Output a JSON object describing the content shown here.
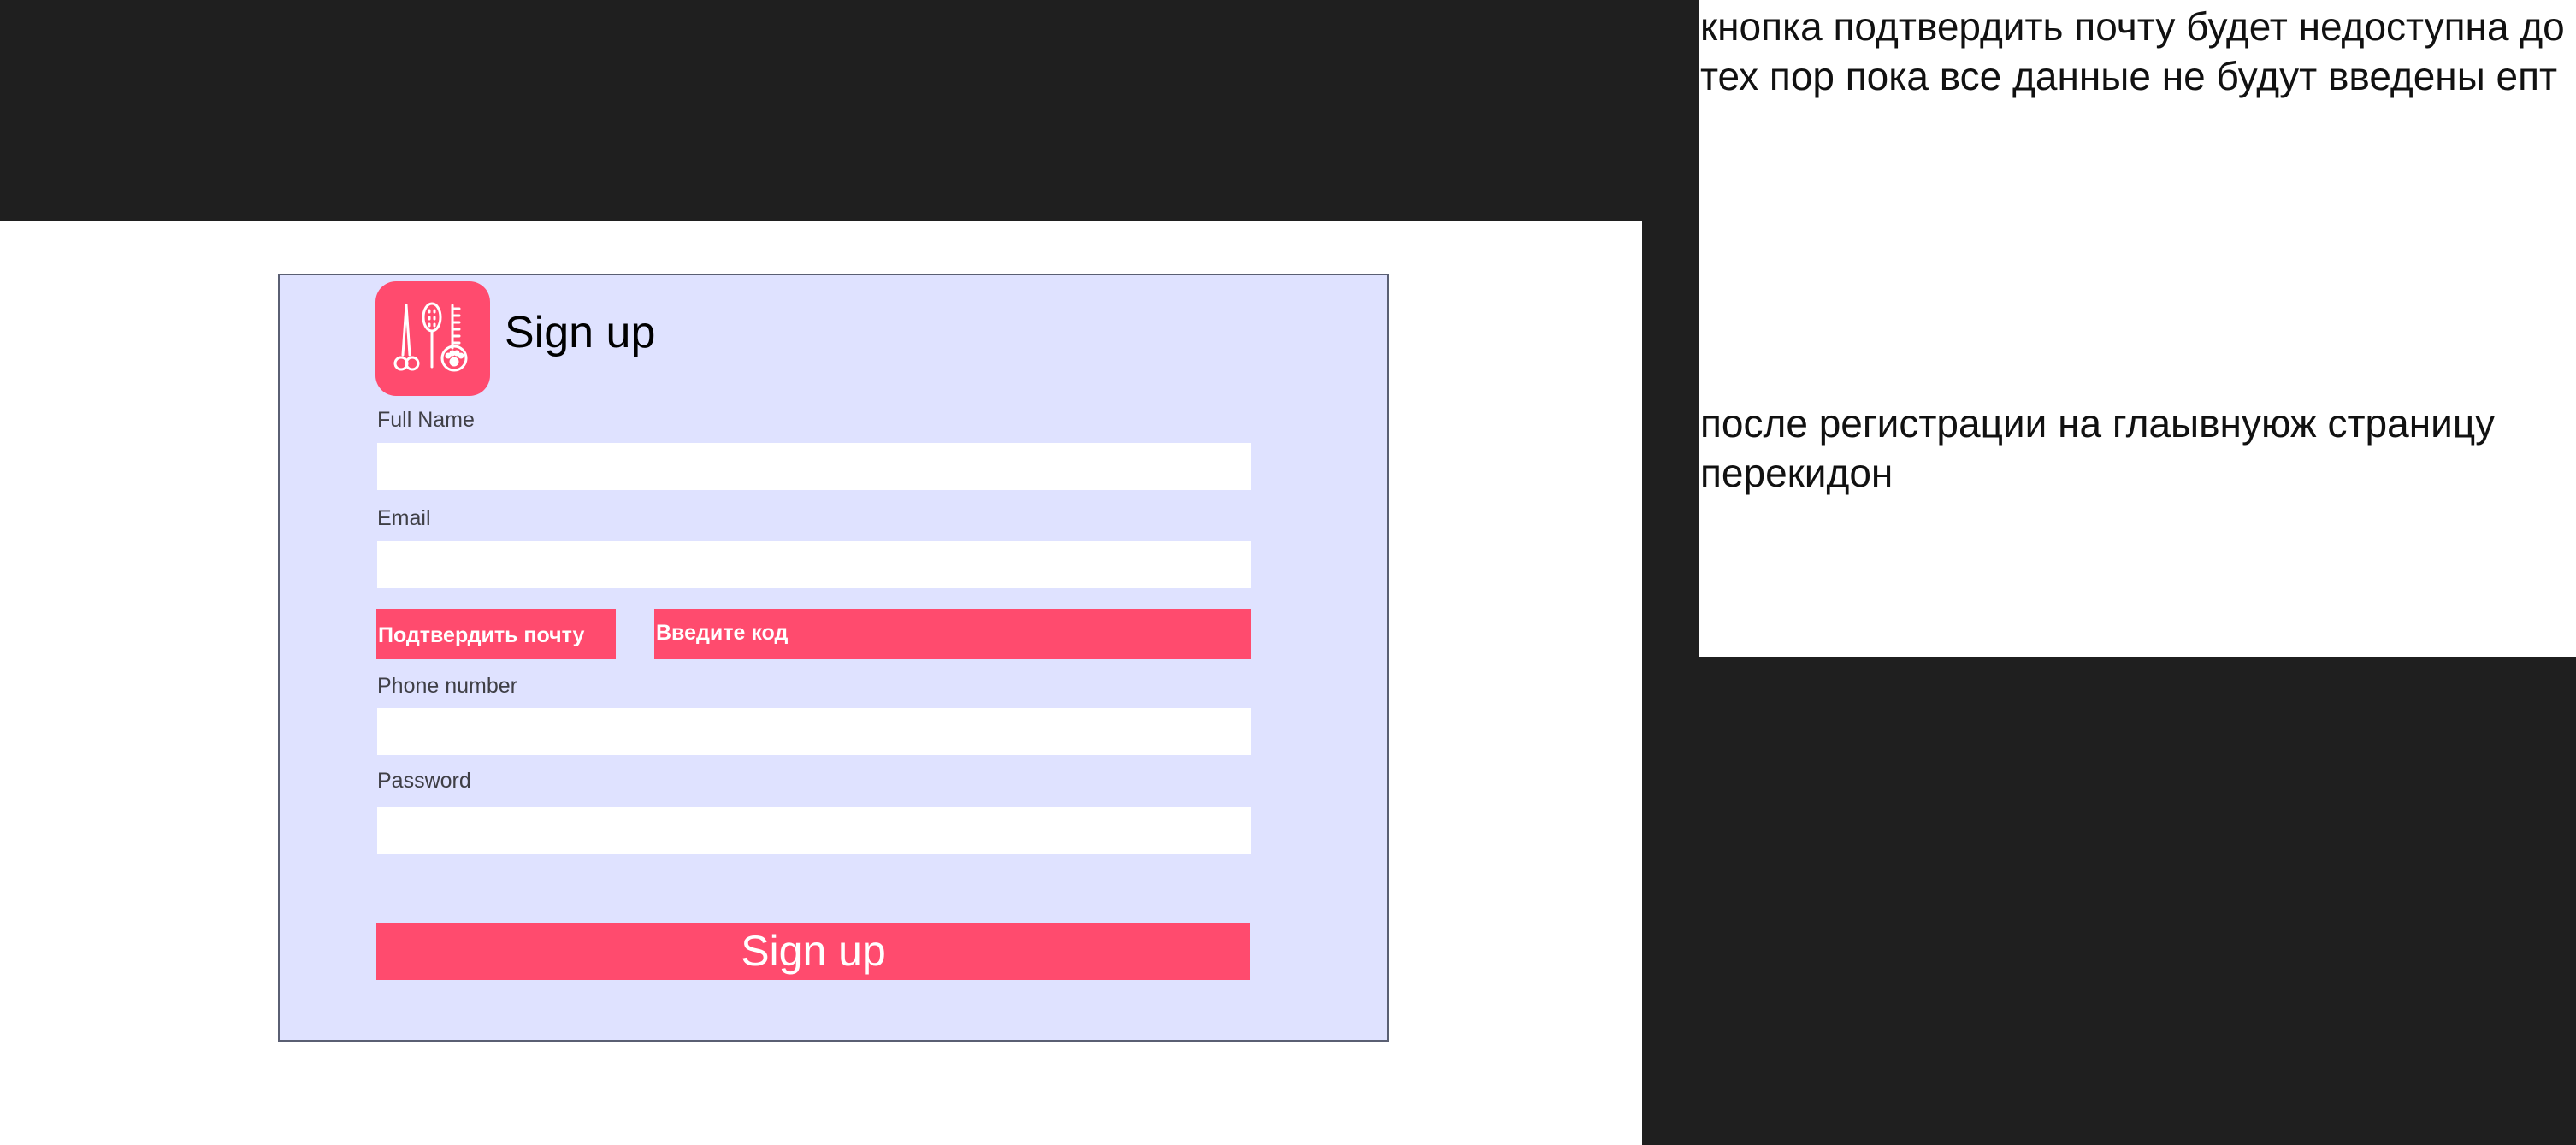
{
  "form": {
    "title": "Sign up",
    "logo_icon": "grooming-tools-icon",
    "full_name_label": "Full Name",
    "full_name_value": "",
    "email_label": "Email",
    "email_value": "",
    "confirm_email_label": "Подтвердить почту",
    "enter_code_label": "Введите код",
    "phone_label": "Phone number",
    "phone_value": "",
    "password_label": "Password",
    "password_value": "",
    "submit_label": "Sign up"
  },
  "notes": {
    "first": "кнопка подтвердить почту будет недоступна до тех пор пока все данные не будут введены епт",
    "second": "после регистрации на глаывнуюж страницу перекидон"
  },
  "colors": {
    "background": "#1f1f1f",
    "card": "#dfe2ff",
    "accent": "#ff4b6e",
    "panel": "#ffffff"
  }
}
